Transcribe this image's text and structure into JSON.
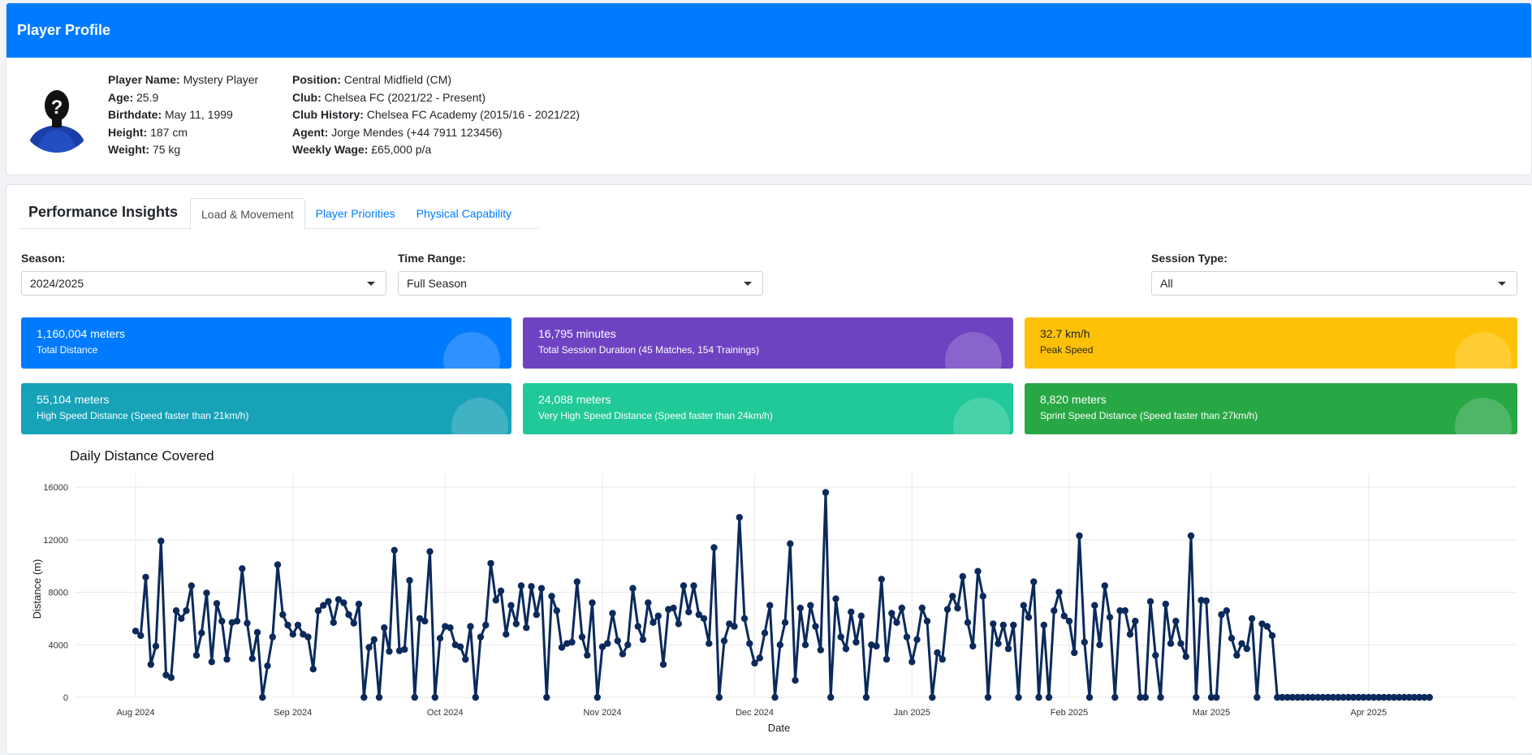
{
  "header": {
    "title": "Player Profile"
  },
  "player": {
    "name_label": "Player Name:",
    "name": "Mystery Player",
    "age_label": "Age:",
    "age": "25.9",
    "birthdate_label": "Birthdate:",
    "birthdate": "May 11, 1999",
    "height_label": "Height:",
    "height": "187 cm",
    "weight_label": "Weight:",
    "weight": "75 kg",
    "position_label": "Position:",
    "position": "Central Midfield (CM)",
    "club_label": "Club:",
    "club": "Chelsea FC (2021/22 - Present)",
    "history_label": "Club History:",
    "history": "Chelsea FC Academy (2015/16 - 2021/22)",
    "agent_label": "Agent:",
    "agent": "Jorge Mendes (+44 7911 123456)",
    "wage_label": "Weekly Wage:",
    "wage": "£65,000 p/a",
    "avatar_glyph": "?"
  },
  "insights": {
    "title": "Performance Insights",
    "tabs": [
      "Load & Movement",
      "Player Priorities",
      "Physical Capability"
    ],
    "active_tab": 0
  },
  "filters": {
    "season_label": "Season:",
    "season": "2024/2025",
    "range_label": "Time Range:",
    "range": "Full Season",
    "session_label": "Session Type:",
    "session": "All"
  },
  "kpis": [
    {
      "value": "1,160,004 meters",
      "label": "Total Distance",
      "color": "#007bff",
      "text_color": "#ffffff",
      "icon": "distance-icon"
    },
    {
      "value": "16,795 minutes",
      "label": "Total Session Duration (45 Matches, 154 Trainings)",
      "color": "#6f42c1",
      "text_color": "#ffffff",
      "icon": "clock-icon"
    },
    {
      "value": "32.7 km/h",
      "label": "Peak Speed",
      "color": "#ffc107",
      "text_color": "#212529",
      "icon": "bolt-icon"
    },
    {
      "value": "55,104 meters",
      "label": "High Speed Distance (Speed faster than 21km/h)",
      "color": "#17a2b8",
      "text_color": "#ffffff",
      "icon": "speedometer-icon"
    },
    {
      "value": "24,088 meters",
      "label": "Very High Speed Distance (Speed faster than 24km/h)",
      "color": "#20c997",
      "text_color": "#ffffff",
      "icon": "speedometer-icon"
    },
    {
      "value": "8,820 meters",
      "label": "Sprint Speed Distance (Speed faster than 27km/h)",
      "color": "#28a745",
      "text_color": "#ffffff",
      "icon": "speedometer-icon"
    }
  ],
  "chart_data": {
    "type": "line",
    "title": "Daily Distance Covered",
    "xlabel": "Date",
    "ylabel": "Distance (m)",
    "ylim": [
      0,
      16500
    ],
    "yticks": [
      0,
      4000,
      8000,
      12000,
      16000
    ],
    "xticks": [
      {
        "date": "2024-08-01",
        "label": "Aug 2024"
      },
      {
        "date": "2024-09-01",
        "label": "Sep 2024"
      },
      {
        "date": "2024-10-01",
        "label": "Oct 2024"
      },
      {
        "date": "2024-11-01",
        "label": "Nov 2024"
      },
      {
        "date": "2024-12-01",
        "label": "Dec 2024"
      },
      {
        "date": "2025-01-01",
        "label": "Jan 2025"
      },
      {
        "date": "2025-02-01",
        "label": "Feb 2025"
      },
      {
        "date": "2025-03-01",
        "label": "Mar 2025"
      },
      {
        "date": "2025-04-01",
        "label": "Apr 2025"
      }
    ],
    "xrange": [
      "2024-07-20",
      "2025-04-30"
    ],
    "grid": true,
    "line_color": "#0b2a5b",
    "series": [
      {
        "x_start": "2024-08-01",
        "x_end": "2025-04-13",
        "values": [
          5050,
          4700,
          9150,
          2500,
          3900,
          11900,
          1700,
          1500,
          6600,
          6000,
          6600,
          8500,
          3200,
          4900,
          7950,
          2700,
          7150,
          5800,
          2900,
          5700,
          5800,
          9800,
          5650,
          2950,
          4950,
          0,
          2400,
          4600,
          10100,
          6300,
          5500,
          4800,
          5500,
          4800,
          4600,
          2150,
          6600,
          7000,
          7300,
          5700,
          7450,
          7200,
          6300,
          5650,
          7100,
          0,
          3800,
          4400,
          0,
          5300,
          3500,
          11200,
          3550,
          3650,
          8900,
          0,
          6000,
          5800,
          11100,
          0,
          4500,
          5400,
          5300,
          4000,
          3850,
          2900,
          5400,
          0,
          4600,
          5500,
          10200,
          7400,
          8100,
          4800,
          7000,
          5600,
          8500,
          5300,
          8450,
          6300,
          8300,
          0,
          7700,
          6600,
          3800,
          4100,
          4200,
          8800,
          4600,
          3200,
          7200,
          0,
          3850,
          4100,
          6400,
          4300,
          3300,
          4000,
          8300,
          5400,
          4400,
          7200,
          5700,
          6200,
          2500,
          6700,
          6800,
          5600,
          8500,
          6500,
          8500,
          6300,
          6000,
          4100,
          11400,
          0,
          4300,
          5600,
          5400,
          13700,
          6000,
          4100,
          2600,
          3000,
          4900,
          7000,
          0,
          4000,
          5700,
          11700,
          1300,
          6800,
          4000,
          7000,
          5400,
          3600,
          15600,
          0,
          7500,
          4600,
          3700,
          6500,
          4200,
          6200,
          0,
          4000,
          3900,
          9000,
          2900,
          6400,
          5700,
          6800,
          4600,
          2700,
          4400,
          6800,
          5800,
          0,
          3400,
          2900,
          6700,
          7700,
          6800,
          9200,
          5700,
          3900,
          9600,
          7700,
          0,
          5600,
          4100,
          5500,
          3700,
          5500,
          0,
          7000,
          6100,
          8800,
          0,
          5500,
          0,
          6600,
          8000,
          6200,
          5800,
          3400,
          12300,
          4200,
          0,
          7000,
          4000,
          8500,
          6100,
          0,
          6600,
          6600,
          4800,
          5800,
          0,
          0,
          7300,
          3200,
          0,
          7100,
          4100,
          5800,
          4100,
          3100,
          12300,
          0,
          7400,
          7350,
          0,
          0,
          6300,
          6600,
          4500,
          3200,
          4100,
          3700,
          6000,
          0,
          5600,
          5400,
          4700,
          0,
          0,
          0,
          0,
          0,
          0,
          0,
          0,
          0,
          0,
          0,
          0,
          0,
          0,
          0,
          0,
          0,
          0,
          0,
          0,
          0,
          0,
          0,
          0,
          0,
          0,
          0,
          0,
          0,
          0,
          0
        ]
      }
    ]
  }
}
